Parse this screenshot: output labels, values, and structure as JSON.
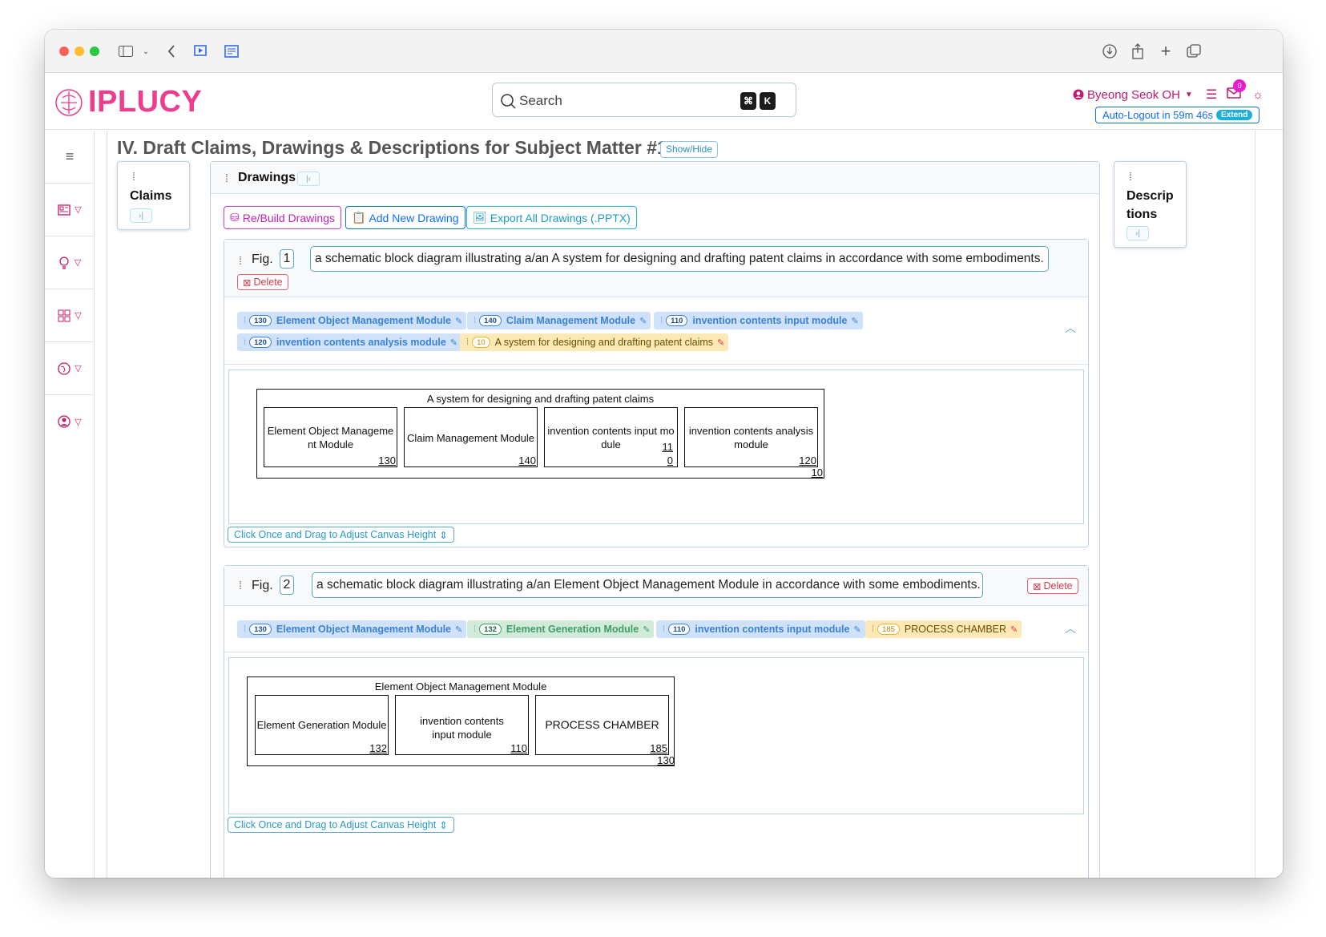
{
  "header": {
    "logo_text": "IPLUCY",
    "search_placeholder": "Search",
    "kbd_cmd": "⌘",
    "kbd_k": "K",
    "user_name": "Byeong Seok OH",
    "notification_count": "0",
    "autologout_text": "Auto-Logout in 59m 46s",
    "extend_label": "Extend"
  },
  "page": {
    "title": "IV. Draft Claims, Drawings & Descriptions for Subject Matter #1",
    "showhide_label": "Show/Hide"
  },
  "claims_panel": {
    "title": "Claims"
  },
  "descriptions_panel": {
    "title_line1": "Descrip",
    "title_line2": "tions"
  },
  "drawings": {
    "title": "Drawings",
    "rebuild_label": "Re/Build Drawings",
    "add_label": "Add New Drawing",
    "export_label": "Export All Drawings (.PPTX)",
    "figures": [
      {
        "fig_label": "Fig.",
        "number": "1",
        "description": "a schematic block diagram illustrating a/an A system for designing and drafting patent claims in accordance with some embodiments.",
        "delete_label": "Delete",
        "chips": [
          {
            "num": "130",
            "label": "Element Object Management Module",
            "color": "blue"
          },
          {
            "num": "140",
            "label": "Claim Management Module",
            "color": "blue"
          },
          {
            "num": "110",
            "label": "invention contents input module",
            "color": "blue"
          },
          {
            "num": "120",
            "label": "invention contents analysis module",
            "color": "blue"
          },
          {
            "num": "10",
            "label": "A system for designing and drafting patent claims",
            "color": "yellow"
          }
        ],
        "diagram": {
          "title": "A system for designing and drafting patent claims",
          "outer_ref": "10",
          "boxes": [
            {
              "line1": "Element Object Manageme",
              "line2": "nt Module",
              "ref": "130"
            },
            {
              "line1": "Claim Management Module",
              "line2": "",
              "ref": "140"
            },
            {
              "line1": "invention contents input mo",
              "line2": "dule",
              "ref_a": "11",
              "ref_b": "0"
            },
            {
              "line1": "invention contents analysis",
              "line2": "module",
              "ref": "120"
            }
          ]
        },
        "adjust_label": "Click Once and Drag to Adjust Canvas Height"
      },
      {
        "fig_label": "Fig.",
        "number": "2",
        "description": "a schematic block diagram illustrating a/an Element Object Management Module in accordance with some embodiments.",
        "delete_label": "Delete",
        "chips": [
          {
            "num": "130",
            "label": "Element Object Management Module",
            "color": "blue"
          },
          {
            "num": "132",
            "label": "Element Generation Module",
            "color": "green"
          },
          {
            "num": "110",
            "label": "invention contents input module",
            "color": "blue"
          },
          {
            "num": "185",
            "label": "PROCESS CHAMBER",
            "color": "yellow"
          }
        ],
        "diagram": {
          "title": "Element Object Management Module",
          "outer_ref": "130",
          "boxes": [
            {
              "line1": "Element Generation Module",
              "line2": "",
              "ref": "132"
            },
            {
              "line1": "invention contents",
              "line2": "input module",
              "ref": "110"
            },
            {
              "line1": "PROCESS CHAMBER",
              "line2": "",
              "ref": "185"
            }
          ]
        },
        "adjust_label": "Click Once and Drag to Adjust Canvas Height"
      }
    ]
  },
  "colors": {
    "brand": "#ee3d8f",
    "accent": "#0d6efd",
    "danger": "#d63a4a",
    "info": "#2a9bc7"
  }
}
